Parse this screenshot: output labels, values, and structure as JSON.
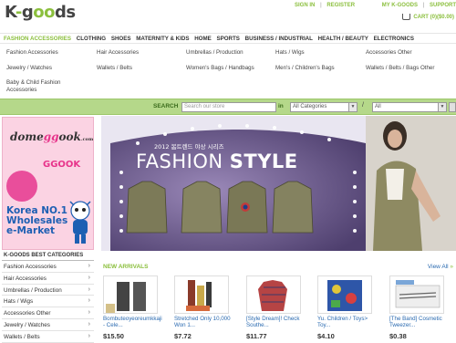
{
  "header": {
    "logo_prefix": "K",
    "logo_dash": "-",
    "logo_g": "g",
    "logo_oo": "oo",
    "logo_suffix": "ds",
    "sign_in": "SIGN IN",
    "register": "REGISTER",
    "my_kgoods": "MY K-GOODS",
    "support": "SUPPORT",
    "sep": "|",
    "cart_label": "CART (0)($0.00)"
  },
  "category_nav": [
    "FASHION ACCESSORIES",
    "CLOTHING",
    "SHOES",
    "MATERNITY & KIDS",
    "HOME",
    "SPORTS",
    "BUSINESS / INDUSTRIAL",
    "HEALTH / BEAUTY",
    "ELECTRONICS"
  ],
  "submenu": [
    [
      "Fashion Accessories",
      "Hair Accessories",
      "Umbrellas / Production",
      "Hats / Wigs",
      "Accessories Other"
    ],
    [
      "Jewelry / Watches",
      "Wallets / Belts",
      "Women's Bags / Handbags",
      "Men's / Children's Bags",
      "Wallets / Belts / Bags Other"
    ],
    [
      "Baby & Child Fashion",
      "Accessories"
    ]
  ],
  "search": {
    "label": "SEARCH",
    "placeholder": "Search our store",
    "in_label": "in",
    "category_value": "All Categories",
    "slash": "/",
    "scope_value": "All"
  },
  "ad": {
    "domeggook_1": "dome",
    "domeggook_oo": "gg",
    "domeggook_2": "ook",
    "domeggook_tld": ".com",
    "ggook": "GGOOK",
    "korea_line1": "Korea NO.1",
    "korea_line2": "Wholesales",
    "korea_line3": "e-Market"
  },
  "best_categories": {
    "title": "K-GOODS BEST CATEGORIES",
    "items": [
      "Fashion Accessories",
      "Hair Accessories",
      "Umbrellas / Production",
      "Hats / Wigs",
      "Accessories Other",
      "Jewelry / Watches",
      "Wallets / Belts"
    ],
    "chevron": "›"
  },
  "banner": {
    "subtitle": "2012 봄트렌드 야상 시리즈",
    "title_part1": "FASHION",
    "title_part2": "STYLE"
  },
  "new_arrivals": {
    "title": "NEW ARRIVALS",
    "view_all": "View All",
    "view_all_plus": "»",
    "products": [
      {
        "name": "Bombuteoyeoreumkkaji - Cele...",
        "price": "$15.50"
      },
      {
        "name": "Stretched Only 10,000 Won 1...",
        "price": "$7.72"
      },
      {
        "name": "[Style Dream]! Check Southe...",
        "price": "$11.77"
      },
      {
        "name": "Yu. Children / Toys> Toy...",
        "price": "$4.10"
      },
      {
        "name": "[The Band] Cosmetic Tweezer...",
        "price": "$0.38"
      }
    ]
  },
  "colors": {
    "accent_green": "#8bbf3d",
    "search_bar_green": "#b5d88a",
    "ad_pink": "#fbd3e3",
    "link_blue": "#2a6ab0"
  }
}
